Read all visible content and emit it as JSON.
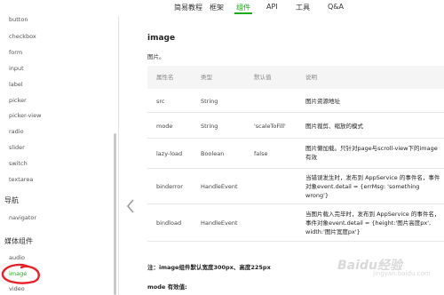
{
  "topnav": {
    "items": [
      "简易教程",
      "框架",
      "组件",
      "API",
      "工具",
      "Q&A"
    ],
    "active_index": 2,
    "accent": "#1aad19"
  },
  "sidebar": {
    "items": [
      "button",
      "checkbox",
      "form",
      "input",
      "label",
      "picker",
      "picker-view",
      "radio",
      "slider",
      "switch",
      "textarea"
    ],
    "section_nav": "导航",
    "nav_items": [
      "navigator"
    ],
    "section_media": "媒体组件",
    "media_items": [
      "audio",
      "image",
      "video"
    ],
    "selected": "image"
  },
  "content": {
    "title": "image",
    "description": "图片。",
    "table": {
      "headers": [
        "属性名",
        "类型",
        "默认值",
        "说明"
      ],
      "rows": [
        [
          "src",
          "String",
          "",
          "图片资源地址"
        ],
        [
          "mode",
          "String",
          "'scaleToFill'",
          "图片裁剪、缩放的模式"
        ],
        [
          "lazy-load",
          "Boolean",
          "false",
          "图片懒加载。只针对page与scroll-view下的image有效"
        ],
        [
          "binderror",
          "HandleEvent",
          "",
          "当错误发生时，发布到 AppService 的事件名，事件对象event.detail = {errMsg: 'something wrong'}"
        ],
        [
          "bindload",
          "HandleEvent",
          "",
          "当图片载入完毕时，发布到 AppService 的事件名，事件对象event.detail = {height:'图片高度px', width:'图片宽度px'}"
        ]
      ]
    },
    "note": "注：image组件默认宽度300px、高度225px",
    "mode_values": "mode 有效值:"
  },
  "watermark": {
    "text": "Baidu经验",
    "sub": "jingyan.baidu.com"
  }
}
